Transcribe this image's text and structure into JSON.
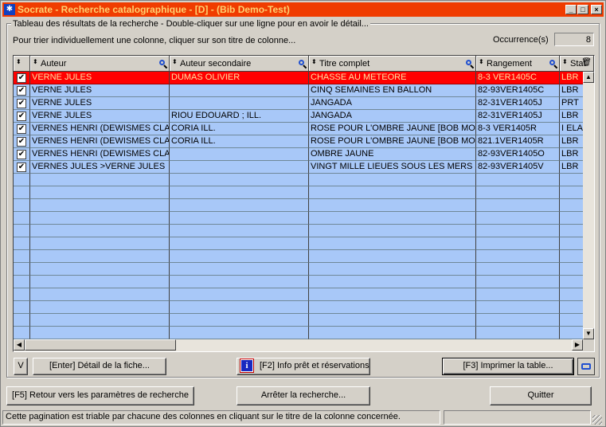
{
  "window": {
    "title": "Socrate - Recherche catalographique - [D] - (Bib Demo-Test)",
    "icon_name": "socrate-app-icon",
    "controls": {
      "minimize": "_",
      "maximize": "□",
      "close": "×"
    }
  },
  "group": {
    "legend": "Tableau des résultats de la recherche - Double-cliquer sur une ligne pour en avoir le détail...",
    "instruction": "Pour trier individuellement une colonne, cliquer sur son titre de colonne...",
    "occurrences_label": "Occurrence(s)",
    "occurrences_value": "8"
  },
  "grid": {
    "columns": [
      {
        "key": "check",
        "label": ""
      },
      {
        "key": "auteur",
        "label": "Auteur"
      },
      {
        "key": "auteur_sec",
        "label": "Auteur secondaire"
      },
      {
        "key": "titre",
        "label": "Titre complet"
      },
      {
        "key": "rangement",
        "label": "Rangement"
      },
      {
        "key": "statut",
        "label": "Stat"
      }
    ],
    "rows": [
      {
        "check": "✔",
        "auteur": "VERNE JULES",
        "auteur_sec": "DUMAS OLIVIER",
        "titre": "CHASSE AU METEORE",
        "rangement": "8-3  VER1405C",
        "statut": "LBR",
        "selected": true
      },
      {
        "check": "✔",
        "auteur": "VERNE JULES",
        "auteur_sec": "",
        "titre": "CINQ SEMAINES EN BALLON",
        "rangement": "82-93VER1405C",
        "statut": "LBR",
        "selected": false
      },
      {
        "check": "✔",
        "auteur": "VERNE JULES",
        "auteur_sec": "",
        "titre": "JANGADA",
        "rangement": "82-31VER1405J",
        "statut": "PRT",
        "selected": false
      },
      {
        "check": "✔",
        "auteur": "VERNE JULES",
        "auteur_sec": "RIOU EDOUARD ; ILL.",
        "titre": "JANGADA",
        "rangement": "82-31VER1405J",
        "statut": "LBR",
        "selected": false
      },
      {
        "check": "✔",
        "auteur": "VERNES HENRI (DEWISMES CLAI",
        "auteur_sec": "CORIA  ILL.",
        "titre": "ROSE POUR L'OMBRE JAUNE   [BOB MO",
        "rangement": "8-3  VER1405R",
        "statut": "I ELA",
        "selected": false
      },
      {
        "check": "✔",
        "auteur": "VERNES HENRI (DEWISMES CLAI",
        "auteur_sec": "CORIA  ILL.",
        "titre": "ROSE POUR L'OMBRE JAUNE   [BOB MO",
        "rangement": "821.1VER1405R",
        "statut": "LBR",
        "selected": false
      },
      {
        "check": "✔",
        "auteur": "VERNES HENRI (DEWISMES CLAI",
        "auteur_sec": "",
        "titre": "OMBRE JAUNE",
        "rangement": "82-93VER1405O",
        "statut": "LBR",
        "selected": false
      },
      {
        "check": "✔",
        "auteur": "VERNES JULES >VERNE JULES",
        "auteur_sec": "",
        "titre": "VINGT MILLE LIEUES SOUS LES MERS",
        "rangement": "82-93VER1405V",
        "statut": "LBR",
        "selected": false
      }
    ]
  },
  "buttons": {
    "v": "V",
    "detail": "[Enter] Détail de la fiche...",
    "info": "[F2] Info prêt et réservations",
    "imprimer": "[F3] Imprimer la table...",
    "retour": "[F5] Retour vers les paramètres de recherche",
    "arreter": "Arrêter la recherche...",
    "quitter": "Quitter"
  },
  "statusbar": {
    "message": "Cette pagination est triable par chacune des colonnes en cliquant sur le titre de la colonne concernée.",
    "panel2": ""
  },
  "colors": {
    "titlebar": "#f03c00",
    "row_background": "#a8c8f8",
    "selected_row": "#ff0000",
    "selected_text": "#ffe0a0"
  }
}
